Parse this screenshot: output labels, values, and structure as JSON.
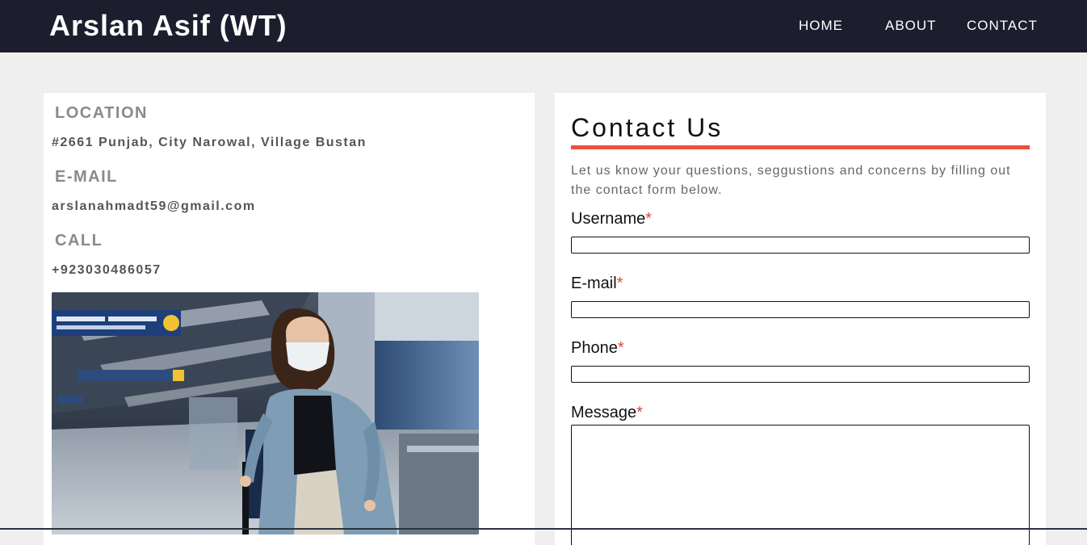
{
  "header": {
    "brand": "Arslan Asif (WT)",
    "nav": [
      {
        "label": "HOME"
      },
      {
        "label": "ABOUT"
      },
      {
        "label": "CONTACT"
      }
    ]
  },
  "info": {
    "location_heading": "LOCATION",
    "location_value": "#2661 Punjab, City Narowal, Village Bustan",
    "email_heading": "E-MAIL",
    "email_value": "arslanahmadt59@gmail.com",
    "call_heading": "CALL",
    "call_value": "+923030486057"
  },
  "contact": {
    "title": "Contact Us",
    "intro": "Let us know your questions, seggustions and concerns by filling out the contact form below.",
    "required_marker": "*",
    "fields": {
      "username": {
        "label": "Username",
        "value": ""
      },
      "email": {
        "label": "E-mail",
        "value": ""
      },
      "phone": {
        "label": "Phone",
        "value": ""
      },
      "message": {
        "label": "Message",
        "value": ""
      }
    }
  },
  "colors": {
    "header_bg": "#1c1e2e",
    "accent": "#f04e3e",
    "page_bg": "#efefef"
  }
}
